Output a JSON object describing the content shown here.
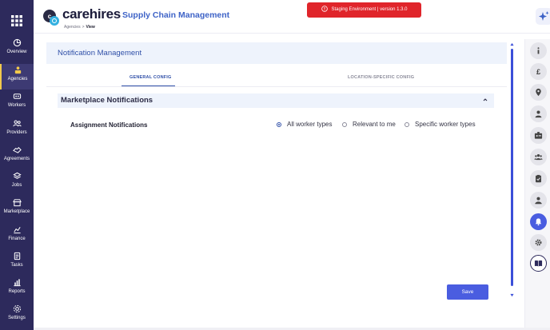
{
  "brand": {
    "logo_text": "carehires",
    "app_title": "Supply Chain Management"
  },
  "breadcrumb": {
    "parent": "Agencies",
    "separator": ">",
    "current": "View"
  },
  "environment_banner": {
    "text": "Staging Environment | version 1.3.0",
    "color": "#e0252b"
  },
  "sidebar": {
    "items": [
      {
        "label": "Overview",
        "icon": "pie-chart-icon"
      },
      {
        "label": "Agencies",
        "icon": "agency-icon",
        "active": true
      },
      {
        "label": "Workers",
        "icon": "workers-icon"
      },
      {
        "label": "Providers",
        "icon": "providers-icon"
      },
      {
        "label": "Agreements",
        "icon": "agreements-icon"
      },
      {
        "label": "Jobs",
        "icon": "jobs-icon"
      },
      {
        "label": "Marketplace",
        "icon": "marketplace-icon"
      },
      {
        "label": "Finance",
        "icon": "finance-icon"
      },
      {
        "label": "Tasks",
        "icon": "tasks-icon"
      },
      {
        "label": "Reports",
        "icon": "reports-icon"
      },
      {
        "label": "Settings",
        "icon": "settings-icon"
      }
    ]
  },
  "panel": {
    "title": "Notification Management",
    "tabs": [
      {
        "label": "GENERAL CONFIG",
        "active": true
      },
      {
        "label": "LOCATION-SPECIFIC CONFIG",
        "active": false
      }
    ]
  },
  "section": {
    "title": "Marketplace Notifications",
    "expanded": true,
    "assignment_label": "Assignment Notifications",
    "options": [
      {
        "label": "All worker types",
        "selected": true
      },
      {
        "label": "Relevant to me",
        "selected": false
      },
      {
        "label": "Specific worker types",
        "selected": false
      }
    ]
  },
  "save_label": "Save",
  "right_rail": {
    "items": [
      {
        "icon": "info-icon"
      },
      {
        "icon": "pound-icon"
      },
      {
        "icon": "location-pin-icon"
      },
      {
        "icon": "user-icon"
      },
      {
        "icon": "id-card-icon"
      },
      {
        "icon": "group-icon"
      },
      {
        "icon": "clipboard-icon"
      },
      {
        "icon": "contact-icon"
      },
      {
        "icon": "bell-icon",
        "active": true
      },
      {
        "icon": "gear-icon"
      },
      {
        "icon": "book-icon"
      }
    ]
  },
  "colors": {
    "sidebar_bg": "#2d2a5c",
    "accent": "#3050a8",
    "primary_button": "#4a5de0",
    "active_marker": "#f2c94c"
  }
}
